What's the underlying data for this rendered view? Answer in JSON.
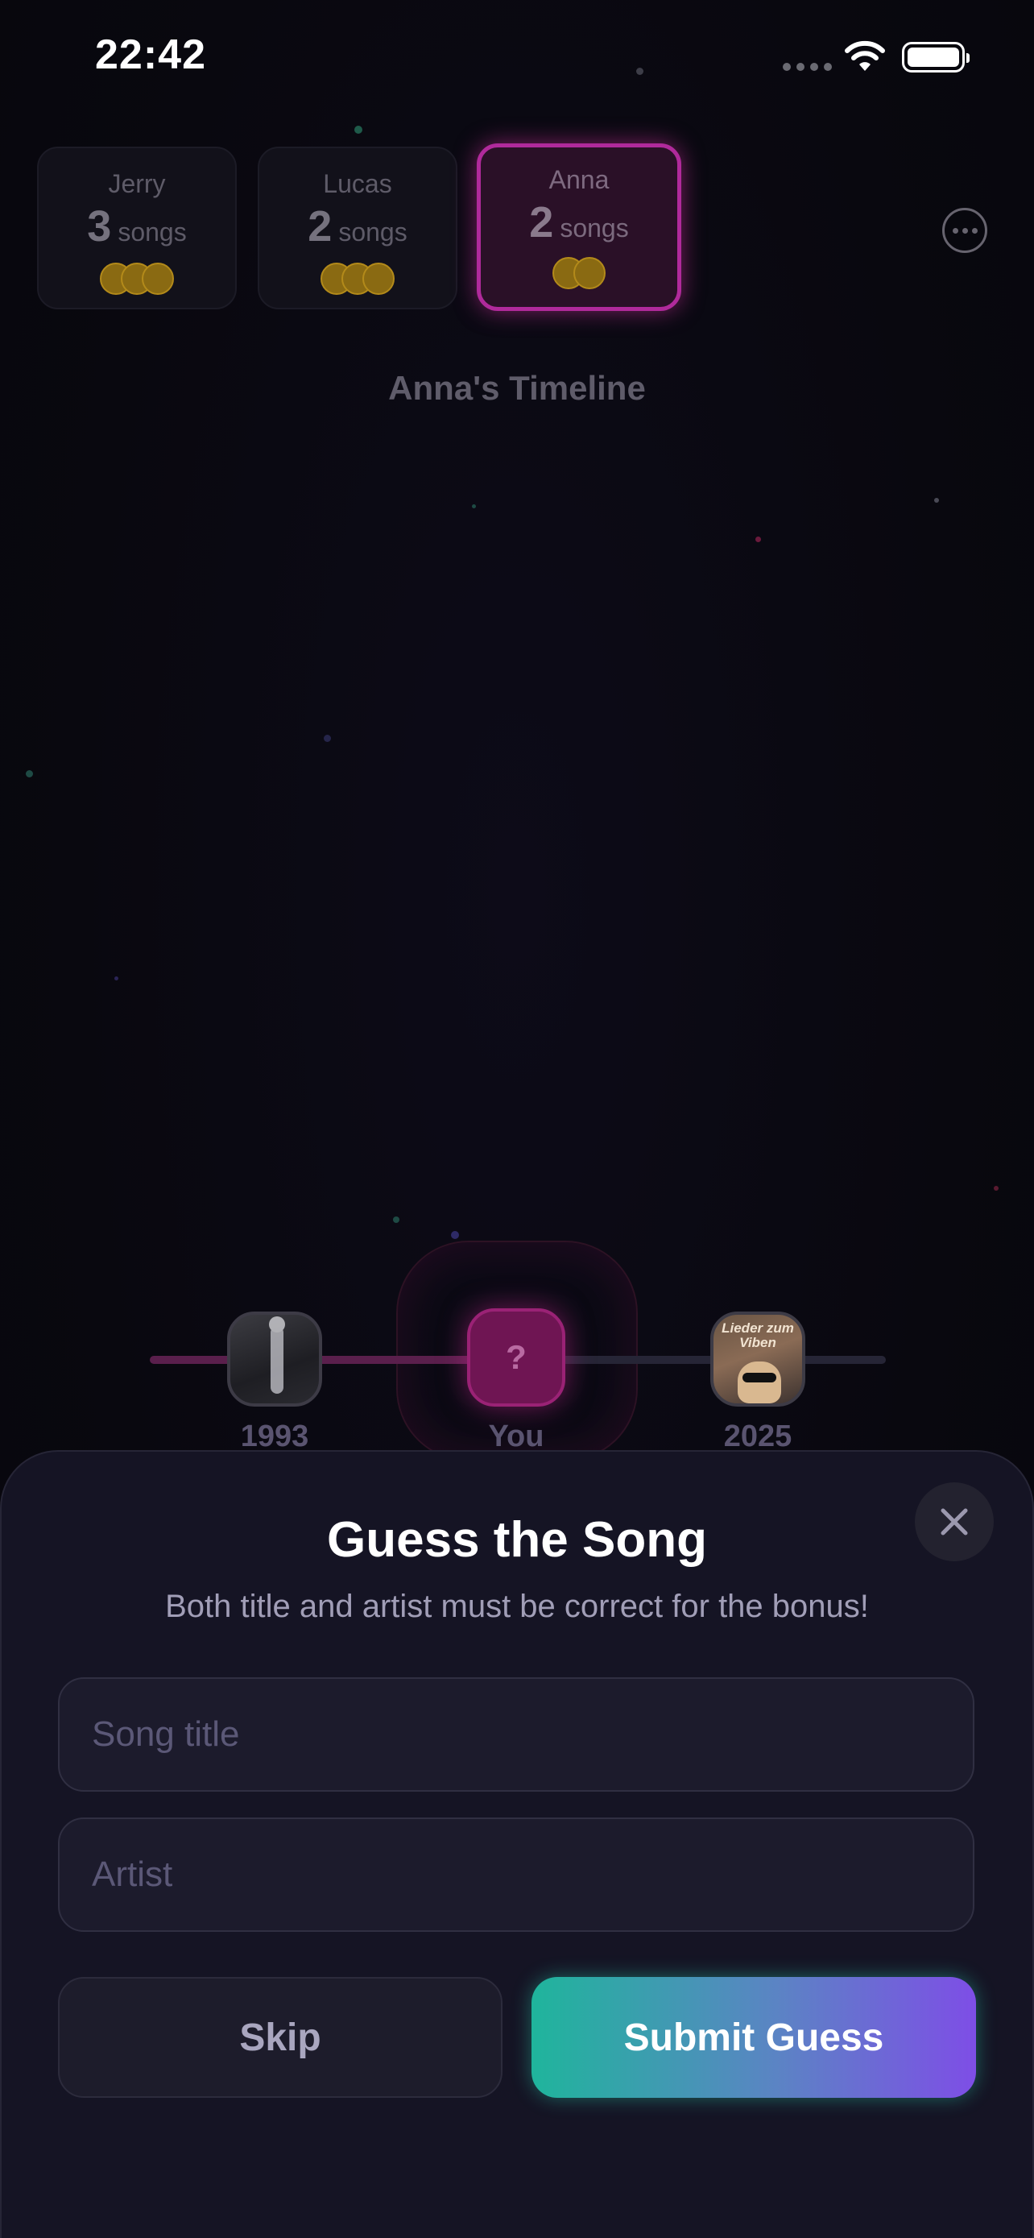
{
  "status_bar": {
    "time": "22:42"
  },
  "players": [
    {
      "name": "Jerry",
      "count": "3",
      "unit": "songs",
      "coins": 3,
      "active": false
    },
    {
      "name": "Lucas",
      "count": "2",
      "unit": "songs",
      "coins": 3,
      "active": false
    },
    {
      "name": "Anna",
      "count": "2",
      "unit": "songs",
      "coins": 2,
      "active": true
    }
  ],
  "timeline": {
    "title": "Anna's Timeline",
    "nodes": [
      {
        "label": "1993",
        "kind": "album-cover"
      },
      {
        "label": "You",
        "kind": "mystery",
        "glyph": "?"
      },
      {
        "label": "2025",
        "kind": "album-cover",
        "cover_text": "Lieder zum Viben"
      }
    ]
  },
  "sheet": {
    "title": "Guess the Song",
    "subtitle": "Both title and artist must be correct for the bonus!",
    "title_placeholder": "Song title",
    "artist_placeholder": "Artist",
    "skip_label": "Skip",
    "submit_label": "Submit Guess"
  },
  "colors": {
    "accent_pink": "#b02a9b",
    "submit_gradient_start": "#1fb59c",
    "submit_gradient_end": "#7e4ee6",
    "sheet_background": "#151424"
  }
}
